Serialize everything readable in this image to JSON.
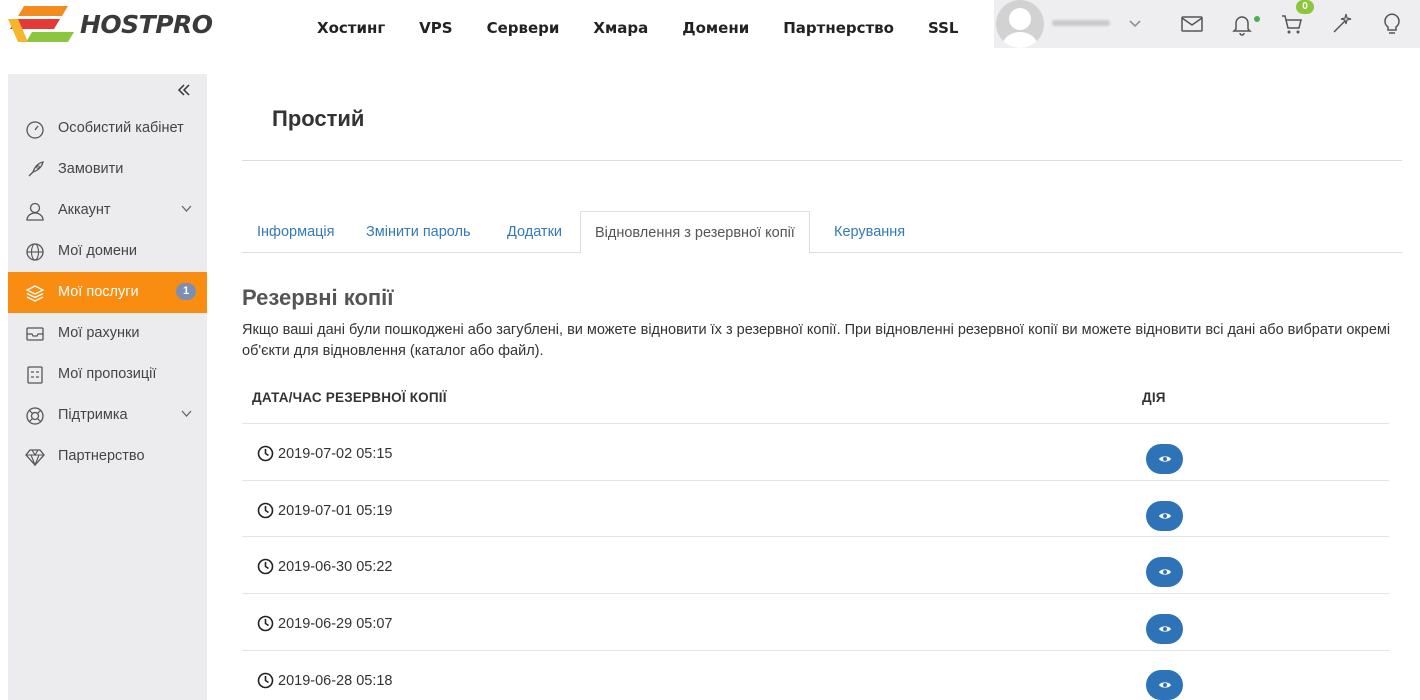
{
  "brand": {
    "name": "HOSTPRO"
  },
  "topnav": [
    "Хостинг",
    "VPS",
    "Сервери",
    "Хмара",
    "Домени",
    "Партнерство",
    "SSL"
  ],
  "header": {
    "cart_count": "0"
  },
  "sidebar": {
    "items": [
      {
        "label": "Особистий кабінет",
        "icon": "speedometer-icon"
      },
      {
        "label": "Замовити",
        "icon": "rocket-icon"
      },
      {
        "label": "Аккаунт",
        "icon": "user-icon",
        "chevron": true
      },
      {
        "label": "Мої домени",
        "icon": "globe-icon"
      },
      {
        "label": "Мої послуги",
        "icon": "layers-icon",
        "active": true,
        "badge": "1"
      },
      {
        "label": "Мої рахунки",
        "icon": "inbox-icon"
      },
      {
        "label": "Мої пропозиції",
        "icon": "calculator-icon"
      },
      {
        "label": "Підтримка",
        "icon": "lifebuoy-icon",
        "chevron": true
      },
      {
        "label": "Партнерство",
        "icon": "diamond-icon"
      }
    ]
  },
  "page": {
    "title": "Простий"
  },
  "tabs": [
    "Інформація",
    "Змінити пароль",
    "Додатки",
    "Відновлення з резервної копії",
    "Керування"
  ],
  "backup": {
    "title": "Резервні копії",
    "description": "Якщо ваші дані були пошкоджені або загублені, ви можете відновити їх з резервної копії. При відновленні резервної копії ви можете відновити всі дані або вибрати окремі об'єкти для відновлення (каталог або файл).",
    "col_date": "ДАТА/ЧАС РЕЗЕРВНОЇ КОПІЇ",
    "col_action": "ДІЯ",
    "rows": [
      "2019-07-02 05:15",
      "2019-07-01 05:19",
      "2019-06-30 05:22",
      "2019-06-29 05:07",
      "2019-06-28 05:18"
    ]
  },
  "colors": {
    "accent": "#f98d11",
    "link": "#337ab7",
    "button": "#2e73b8",
    "badge": "#8cc63e"
  }
}
